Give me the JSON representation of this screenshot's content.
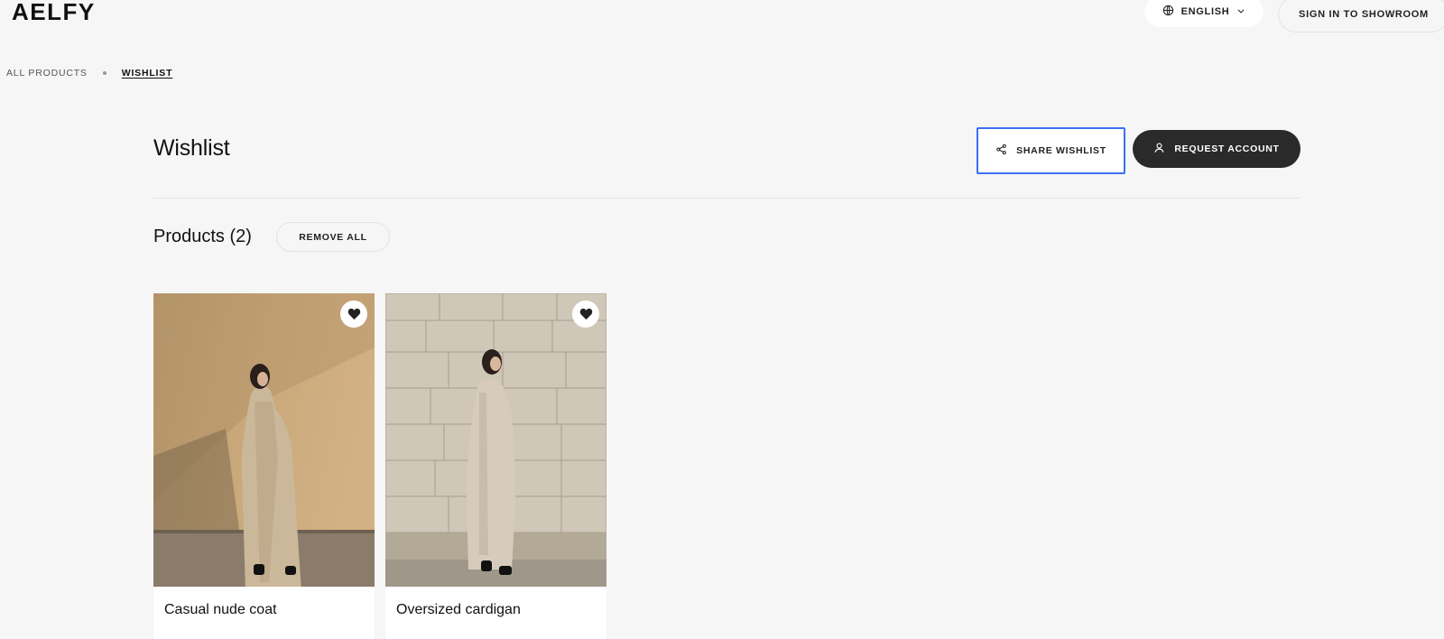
{
  "header": {
    "logo": "AELFY",
    "language_label": "ENGLISH",
    "signin_label": "SIGN IN TO SHOWROOM"
  },
  "breadcrumb": {
    "items": [
      "ALL PRODUCTS",
      "WISHLIST"
    ]
  },
  "wishlist": {
    "title": "Wishlist",
    "share_label": "SHARE WISHLIST",
    "request_label": "REQUEST ACCOUNT"
  },
  "products": {
    "heading": "Products (2)",
    "remove_all_label": "REMOVE ALL",
    "items": [
      {
        "name": "Casual nude coat"
      },
      {
        "name": "Oversized cardigan"
      }
    ]
  },
  "colors": {
    "background": "#f6f6f6",
    "focus_outline": "#3b6ff5",
    "dark_button": "#2a2a2a"
  },
  "icons": {
    "language": "globe-icon",
    "language_toggle": "chevron-down-icon",
    "share": "share-icon",
    "account": "user-icon",
    "wishlist": "heart-icon"
  }
}
